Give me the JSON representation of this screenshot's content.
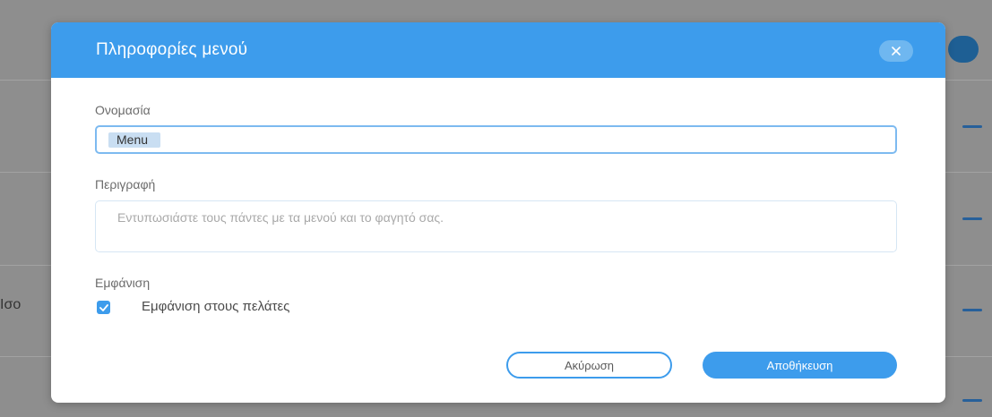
{
  "background": {
    "side_text": "Ισο"
  },
  "dialog": {
    "title": "Πληροφορίες μενού",
    "close_icon": "close-icon",
    "name_label": "Ονομασία",
    "name_value": "Menu",
    "description_label": "Περιγραφή",
    "description_placeholder": "Εντυπωσιάστε τους πάντες με τα μενού και το φαγητό σας.",
    "visibility_label": "Εμφάνιση",
    "visibility_checkbox_label": "Εμφάνιση στους πελάτες",
    "visibility_checked": true,
    "cancel_label": "Ακύρωση",
    "save_label": "Αποθήκευση"
  },
  "colors": {
    "accent": "#3d9cec",
    "overlay": "#8e8e8e"
  }
}
